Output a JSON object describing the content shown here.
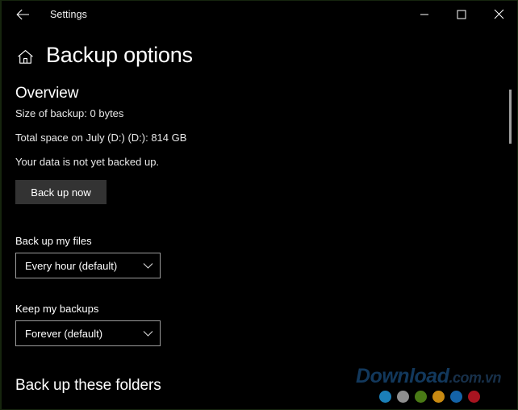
{
  "titlebar": {
    "back_icon": "back-arrow-icon",
    "app_title": "Settings",
    "minimize_icon": "minimize-icon",
    "maximize_icon": "maximize-icon",
    "close_icon": "close-icon"
  },
  "header": {
    "home_icon": "home-icon",
    "page_title": "Backup options"
  },
  "overview": {
    "heading": "Overview",
    "size_of_backup": "Size of backup: 0 bytes",
    "total_space": "Total space on July (D:) (D:): 814 GB",
    "status": "Your data is not yet backed up.",
    "back_up_now_label": "Back up now"
  },
  "backup_files": {
    "label": "Back up my files",
    "value": "Every hour (default)",
    "chevron_icon": "chevron-down-icon"
  },
  "keep_backups": {
    "label": "Keep my backups",
    "value": "Forever (default)",
    "chevron_icon": "chevron-down-icon"
  },
  "folders_section": {
    "heading": "Back up these folders"
  },
  "scrollbar": {
    "thumb_name": "scrollbar-thumb"
  },
  "watermark": {
    "main": "Download",
    "suffix": ".com.vn",
    "dots": [
      "#1b7fb8",
      "#8f8f8f",
      "#4a7a16",
      "#c98a12",
      "#1463a8",
      "#a81420"
    ]
  },
  "colors": {
    "background": "#000000",
    "text": "#ffffff",
    "button_bg": "#333333",
    "combo_border": "#9b9b9b",
    "scrollbar_thumb": "#9d9d9d"
  }
}
